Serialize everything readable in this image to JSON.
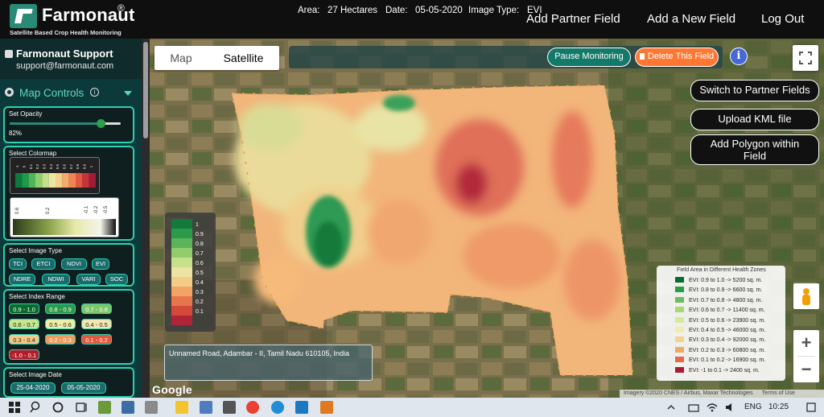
{
  "brand": {
    "name": "Farmonaut",
    "reg": "®",
    "tagline": "Satellite Based Crop Health Monitoring"
  },
  "nav": {
    "add_partner_field": "Add Partner Field",
    "add_new_field": "Add a New Field",
    "logout": "Log Out"
  },
  "support": {
    "name": "Farmonaut Support",
    "email": "support@farmonaut.com"
  },
  "map_controls": {
    "title": "Map Controls",
    "info": "i",
    "opacity": {
      "label": "Set Opacity",
      "value": "82%",
      "fraction": 0.82
    },
    "colormap": {
      "label": "Select Colormap",
      "scale1_labels": [
        "-1",
        "0",
        "0.1",
        "0.2",
        "0.3",
        "0.4",
        "0.5",
        "0.6",
        "0.7",
        "0.8",
        "0.9",
        "1"
      ],
      "scale1_colors": [
        "#0b7a3c",
        "#1f9a4a",
        "#4fb45a",
        "#8dcf6a",
        "#c4e08b",
        "#ece6a4",
        "#f4d089",
        "#f5ad6b",
        "#ef8553",
        "#e0583f",
        "#c8333a",
        "#a01d3a"
      ],
      "scale2_labels": [
        "0.6",
        "0.2",
        "-0.1",
        "-0.2",
        "-0.5"
      ]
    },
    "image_type": {
      "label": "Select Image Type",
      "options": [
        "TCI",
        "ETCI",
        "NDVI",
        "EVI",
        "NDRE",
        "NDWI",
        "VARI",
        "SOC"
      ]
    },
    "index_range": {
      "label": "Select Index Range",
      "options": [
        "0.9 - 1.0",
        "0.8 - 0.9",
        "0.7 - 0.8",
        "0.6 - 0.7",
        "0.5 - 0.6",
        "0.4 - 0.5",
        "0.3 - 0.4",
        "0.2 - 0.3",
        "0.1 - 0.2",
        "-1.0 - 0.1"
      ],
      "colors": [
        "#0b6b2f",
        "#2b9a4b",
        "#7fc56a",
        "#c7e58f",
        "#ecefa8",
        "#f4e6b3",
        "#f3c98a",
        "#ee9b5c",
        "#e2573e",
        "#b31d2a"
      ]
    },
    "image_date": {
      "label": "Select Image Date",
      "dates": [
        "25-04-2020",
        "05-05-2020"
      ]
    }
  },
  "map": {
    "tabs": [
      "Map",
      "Satellite"
    ],
    "active_tab": "Satellite",
    "info_bar": {
      "area_label": "Area:",
      "area_value": "27 Hectares",
      "date_label": "Date:",
      "date_value": "05-05-2020",
      "image_type_label": "Image Type:",
      "image_type_value": "EVI"
    },
    "pause_label": "Pause Monitoring",
    "delete_label": "Delete This Field",
    "info_icon": "i",
    "right_buttons": [
      "Switch to Partner Fields",
      "Upload KML file",
      "Add Polygon within Field"
    ],
    "vertical_legend": {
      "labels": [
        "1",
        "0.9",
        "0.8",
        "0.7",
        "0.6",
        "0.5",
        "0.4",
        "0.3",
        "0.2",
        "0.1"
      ],
      "colors": [
        "#137a3c",
        "#2c9a4a",
        "#5bb35a",
        "#92cc6c",
        "#c7e08b",
        "#eee4a2",
        "#f4cb87",
        "#f2a466",
        "#e7754b",
        "#d34a3b",
        "#b0243a"
      ]
    },
    "zone_legend": {
      "title": "Field Area in Different Health Zones",
      "rows": [
        {
          "label": "EVI: 0.9 to 1.0 -> 5200 sq. m.",
          "color": "#0b6b2f"
        },
        {
          "label": "EVI: 0.8 to 0.9 -> 6600 sq. m.",
          "color": "#2b9a4b"
        },
        {
          "label": "EVI: 0.7 to 0.8 -> 4800 sq. m.",
          "color": "#6dbb60"
        },
        {
          "label": "EVI: 0.6 to 0.7 -> 11400 sq. m.",
          "color": "#a9d678"
        },
        {
          "label": "EVI: 0.5 to 0.6 -> 23900 sq. m.",
          "color": "#d8ea97"
        },
        {
          "label": "EVI: 0.4 to 0.5 -> 46000 sq. m.",
          "color": "#f2eab0"
        },
        {
          "label": "EVI: 0.3 to 0.4 -> 92000 sq. m.",
          "color": "#f5d193"
        },
        {
          "label": "EVI: 0.2 to 0.3 -> 60800 sq. m.",
          "color": "#f0a868"
        },
        {
          "label": "EVI: 0.1 to 0.2 -> 16900 sq. m.",
          "color": "#e2694a"
        },
        {
          "label": "EVI: -1 to 0.1 -> 2400 sq. m.",
          "color": "#a81c33"
        }
      ]
    },
    "address": "Unnamed Road, Adambar - II, Tamil Nadu 610105, India",
    "google": "Google",
    "attribution": "Imagery ©2020 CNES / Airbus, Maxar Technologies",
    "terms": "Terms of Use",
    "zoom_in": "+",
    "zoom_out": "−"
  },
  "taskbar": {
    "language": "ENG",
    "time": "10:25",
    "icons": [
      "windows-icon",
      "search-icon",
      "cortana-icon",
      "task-view-icon",
      "app-icon-1",
      "app-icon-2",
      "app-icon-3",
      "app-icon-4",
      "file-explorer-icon",
      "chrome-icon",
      "edge-icon",
      "vscode-icon",
      "app-icon-5"
    ]
  }
}
